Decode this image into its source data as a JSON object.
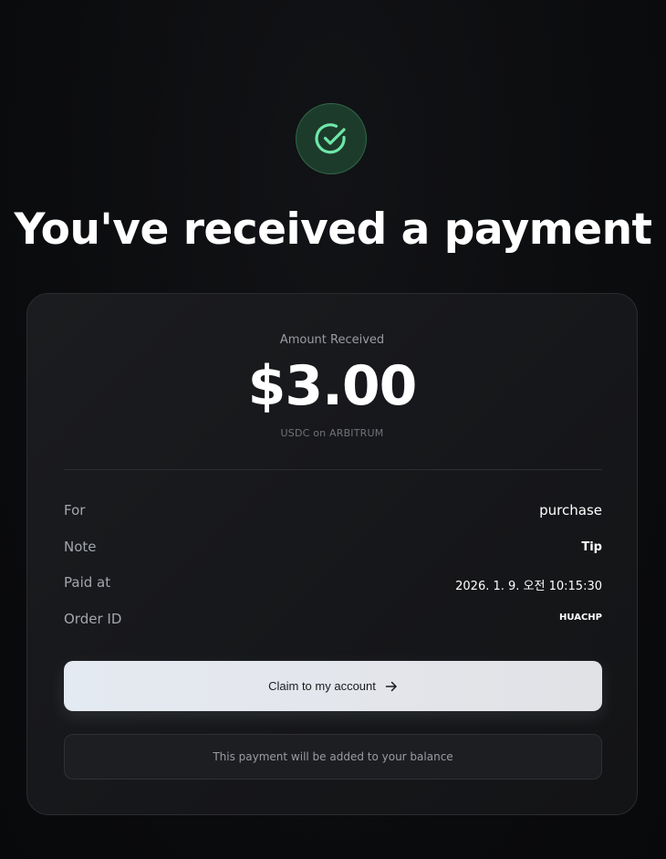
{
  "header": {
    "title": "You've received a payment",
    "status_icon": "check-circle-icon",
    "accent_color": "#6ee7a8"
  },
  "payment": {
    "amount_label": "Amount Received",
    "amount": "$3.00",
    "network": "USDC on ARBITRUM"
  },
  "details": [
    {
      "label": "For",
      "value": "purchase"
    },
    {
      "label": "Note",
      "value": "Tip"
    },
    {
      "label": "Paid at",
      "value": "2026. 1. 9. 오전 10:15:30"
    },
    {
      "label": "Order ID",
      "value": "HUACHP"
    }
  ],
  "actions": {
    "claim_label": "Claim to my account",
    "claim_icon": "arrow-right-icon"
  },
  "info": {
    "message": "This payment will be added to your balance"
  }
}
